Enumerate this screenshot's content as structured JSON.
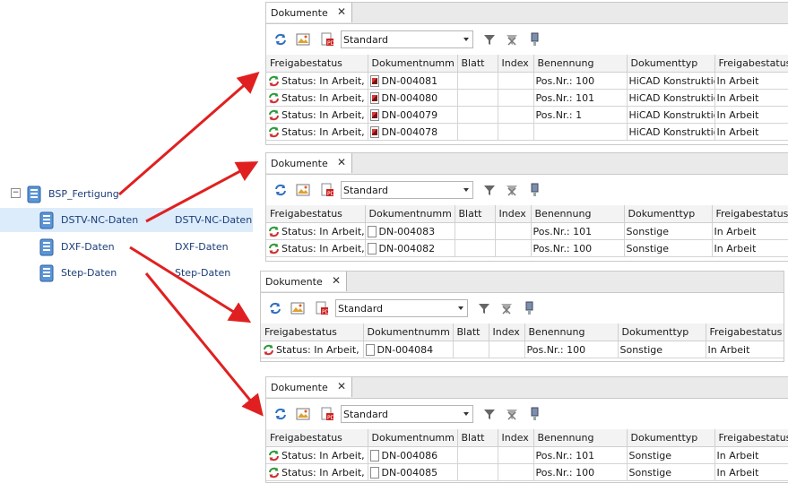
{
  "tree": {
    "root": "BSP_Fertigung",
    "expand": "−",
    "children": [
      {
        "label": "DSTV-NC-Daten",
        "value": "DSTV-NC-Daten"
      },
      {
        "label": "DXF-Daten",
        "value": "DXF-Daten"
      },
      {
        "label": "Step-Daten",
        "value": "Step-Daten"
      }
    ]
  },
  "panel_common": {
    "tab_label": "Dokumente",
    "close": "✕",
    "combo_value": "Standard"
  },
  "panels": [
    {
      "headers": [
        "Freigabestatus",
        "Dokumentnumm",
        "Blatt",
        "Index",
        "Benennung",
        "Dokumenttyp",
        "Freigabestatus"
      ],
      "rows": [
        [
          "Status: In Arbeit,",
          "DN-004081",
          "",
          "",
          "Pos.Nr.: 100",
          "HiCAD Konstruktio",
          "In Arbeit"
        ],
        [
          "Status: In Arbeit,",
          "DN-004080",
          "",
          "",
          "Pos.Nr.: 101",
          "HiCAD Konstruktio",
          "In Arbeit"
        ],
        [
          "Status: In Arbeit,",
          "DN-004079",
          "",
          "",
          "Pos.Nr.: 1",
          "HiCAD Konstruktio",
          "In Arbeit"
        ],
        [
          "Status: In Arbeit,",
          "DN-004078",
          "",
          "",
          "",
          "HiCAD Konstruktio",
          "In Arbeit"
        ]
      ]
    },
    {
      "headers": [
        "Freigabestatus",
        "Dokumentnumm",
        "Blatt",
        "Index",
        "Benennung",
        "Dokumenttyp",
        "Freigabestatus"
      ],
      "rows": [
        [
          "Status: In Arbeit,",
          "DN-004083",
          "",
          "",
          "Pos.Nr.: 101",
          "Sonstige",
          "In Arbeit"
        ],
        [
          "Status: In Arbeit,",
          "DN-004082",
          "",
          "",
          "Pos.Nr.: 100",
          "Sonstige",
          "In Arbeit"
        ]
      ]
    },
    {
      "headers": [
        "Freigabestatus",
        "Dokumentnumm",
        "Blatt",
        "Index",
        "Benennung",
        "Dokumenttyp",
        "Freigabestatus"
      ],
      "rows": [
        [
          "Status: In Arbeit,",
          "DN-004084",
          "",
          "",
          "Pos.Nr.: 100",
          "Sonstige",
          "In Arbeit"
        ]
      ]
    },
    {
      "headers": [
        "Freigabestatus",
        "Dokumentnumm",
        "Blatt",
        "Index",
        "Benennung",
        "Dokumenttyp",
        "Freigabestatus"
      ],
      "rows": [
        [
          "Status: In Arbeit,",
          "DN-004086",
          "",
          "",
          "Pos.Nr.: 101",
          "Sonstige",
          "In Arbeit"
        ],
        [
          "Status: In Arbeit,",
          "DN-004085",
          "",
          "",
          "Pos.Nr.: 100",
          "Sonstige",
          "In Arbeit"
        ]
      ]
    }
  ],
  "icons": {
    "toolbar": [
      "sync-icon",
      "image-icon",
      "pdf-icon",
      "filter-icon",
      "clear-filter-icon",
      "usb-icon"
    ],
    "status": "status-cycle-icon",
    "doc_red": "hicad-document-icon",
    "doc_blank": "blank-document-icon"
  },
  "colors": {
    "arrow": "#e02020",
    "link_text": "#1c3d7a",
    "selection": "#dcecfb"
  }
}
